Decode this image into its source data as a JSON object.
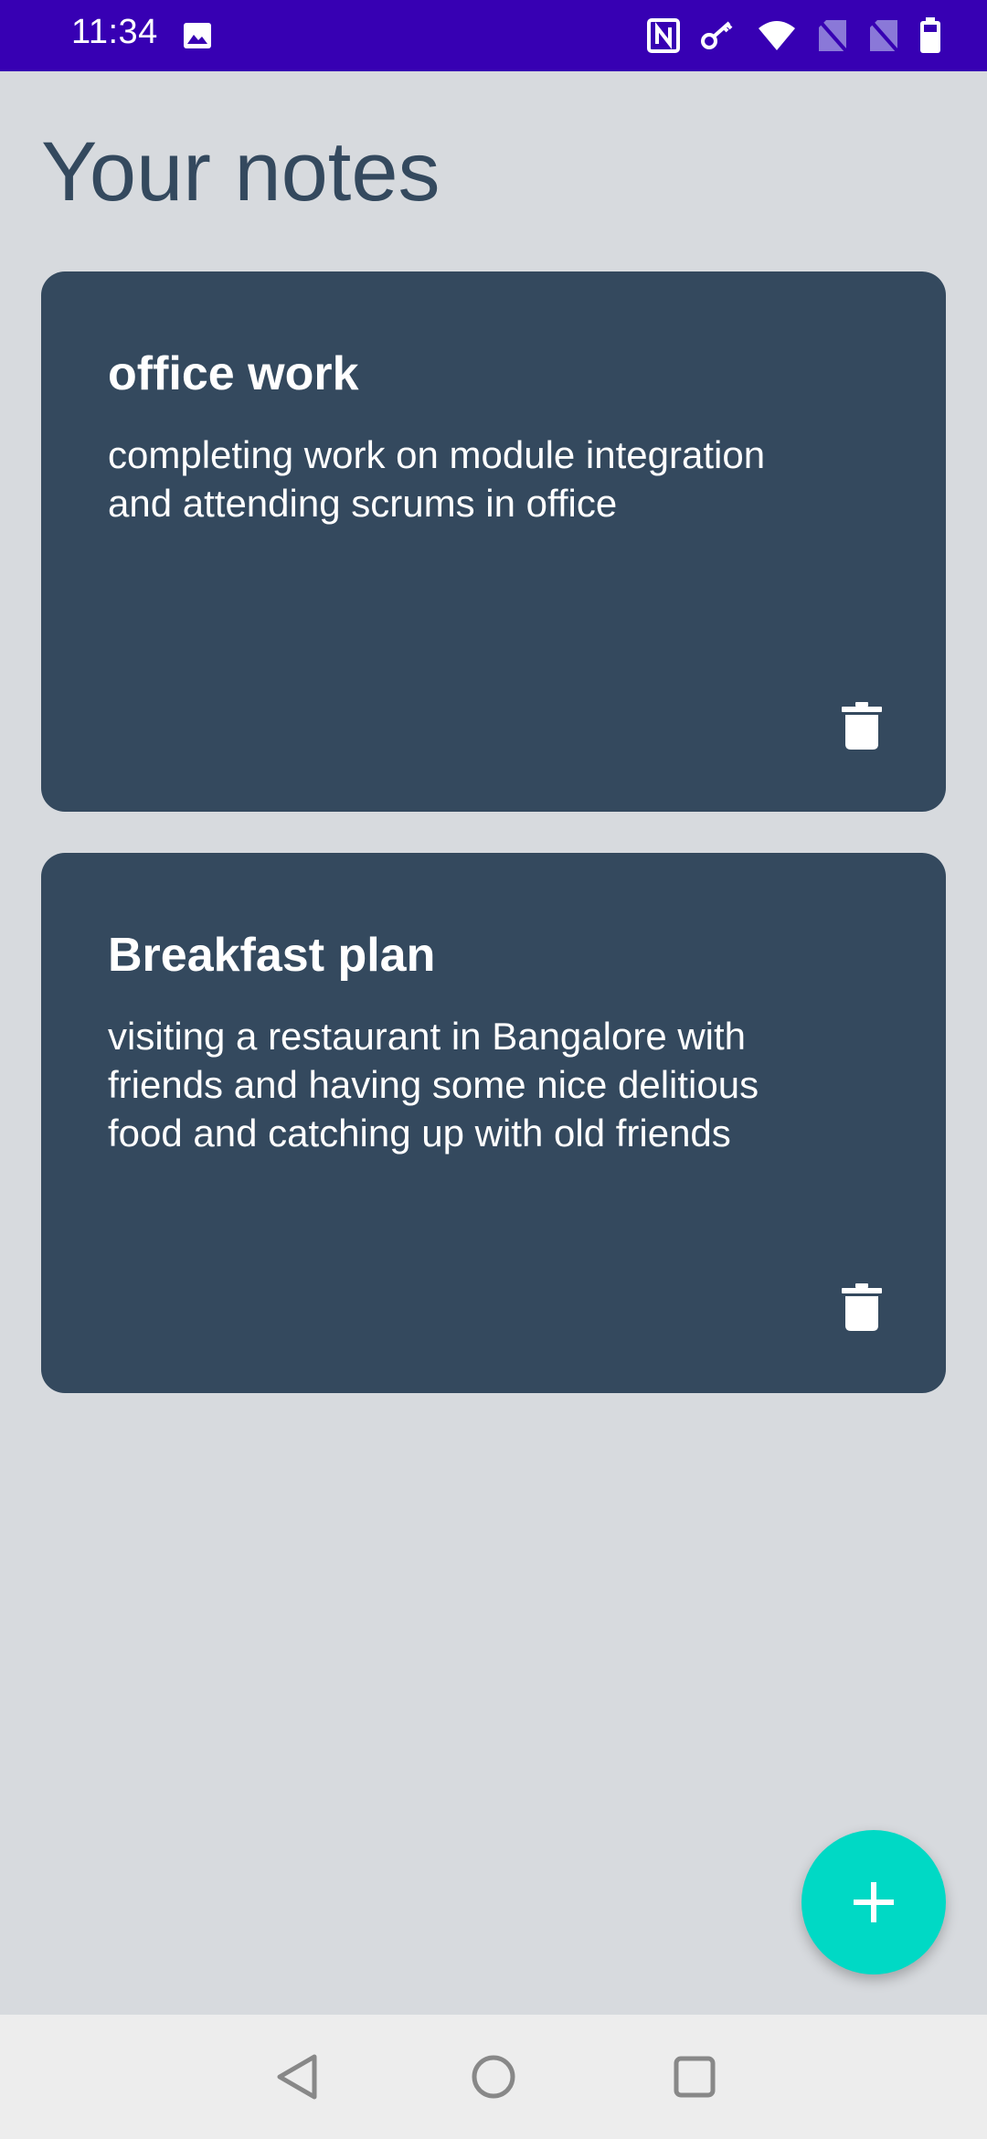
{
  "status_bar": {
    "time": "11:34",
    "background_color": "#3700B3",
    "icons": [
      "gallery-icon",
      "nfc-icon",
      "vpn-key-icon",
      "wifi-icon",
      "no-sim-icon",
      "no-sim-icon",
      "battery-icon"
    ]
  },
  "header": {
    "title": "Your notes"
  },
  "notes": [
    {
      "title": "office work",
      "body": "completing work on module integration and attending scrums in office",
      "delete_icon": "trash-icon"
    },
    {
      "title": "Breakfast plan",
      "body": "visiting a restaurant in Bangalore with friends and having some nice delitious food and catching up with old friends",
      "delete_icon": "trash-icon"
    }
  ],
  "fab": {
    "icon": "plus-icon",
    "color": "#00D9C5"
  },
  "nav_bar": {
    "buttons": [
      "back-icon",
      "home-icon",
      "recents-icon"
    ]
  },
  "colors": {
    "background": "#D7DADE",
    "card": "#34495E",
    "title_text": "#34495E"
  }
}
